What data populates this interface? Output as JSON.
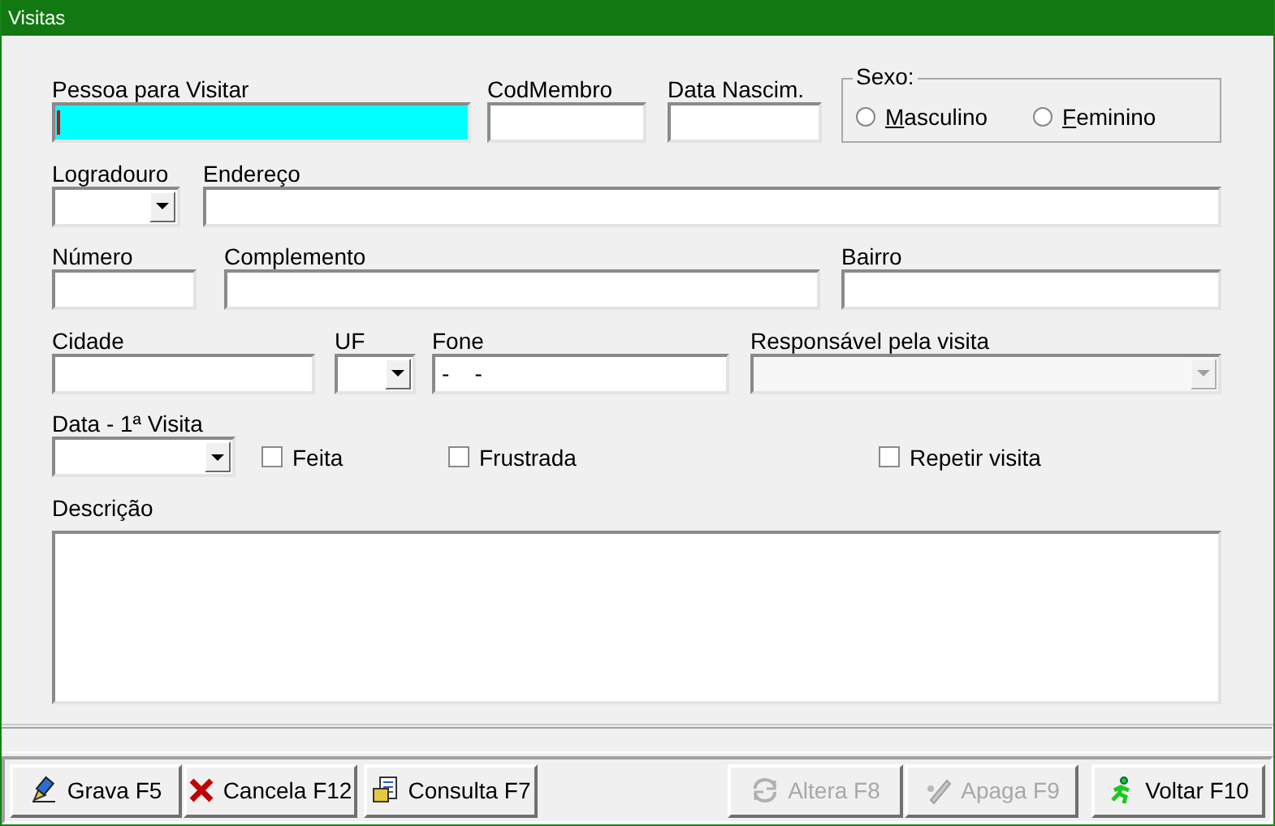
{
  "window": {
    "title": "Visitas"
  },
  "rows": [
    {
      "items": [
        {
          "kind": "text",
          "label": "Pessoa para Visitar",
          "focused": true
        },
        {
          "kind": "text",
          "label": "CodMembro",
          "focused": false
        },
        {
          "kind": "text",
          "label": "Data Nascim.",
          "focused": false
        },
        {
          "kind": "radio_group",
          "label": "Sexo:",
          "options": [
            {
              "label": "Masculino",
              "selected": false
            },
            {
              "label": "Feminino",
              "selected": false
            }
          ]
        }
      ]
    },
    {
      "items": [
        {
          "kind": "combo",
          "label": "Logradouro",
          "disabled": false
        },
        {
          "kind": "text",
          "label": "Endereço",
          "focused": false
        }
      ]
    },
    {
      "items": [
        {
          "kind": "text",
          "label": "Número",
          "focused": false
        },
        {
          "kind": "text",
          "label": "Complemento",
          "focused": false
        },
        {
          "kind": "text",
          "label": "Bairro",
          "focused": false
        }
      ]
    },
    {
      "items": [
        {
          "kind": "text",
          "label": "Cidade",
          "focused": false
        },
        {
          "kind": "combo",
          "label": "UF",
          "disabled": false
        },
        {
          "kind": "text",
          "label": "Fone",
          "value": "-    -",
          "focused": false
        },
        {
          "kind": "combo",
          "label": "Responsável pela visita",
          "disabled": true
        }
      ]
    },
    {
      "items": [
        {
          "kind": "combo",
          "label": "Data - 1ª Visita",
          "disabled": false
        },
        {
          "kind": "checkbox",
          "label": "Feita",
          "checked": false
        },
        {
          "kind": "checkbox",
          "label": "Frustrada",
          "checked": false
        },
        {
          "kind": "checkbox",
          "label": "Repetir visita",
          "checked": false
        }
      ]
    },
    {
      "items": [
        {
          "kind": "textarea",
          "label": "Descrição",
          "focused": false
        }
      ]
    }
  ],
  "buttons": [
    {
      "label": "Grava F5",
      "disabled": false
    },
    {
      "label": "Cancela F12",
      "disabled": false
    },
    {
      "label": "Consulta F7",
      "disabled": false
    },
    {
      "label": "Altera F8",
      "disabled": true
    },
    {
      "label": "Apaga F9",
      "disabled": true
    },
    {
      "label": "Voltar F10",
      "disabled": false
    }
  ]
}
